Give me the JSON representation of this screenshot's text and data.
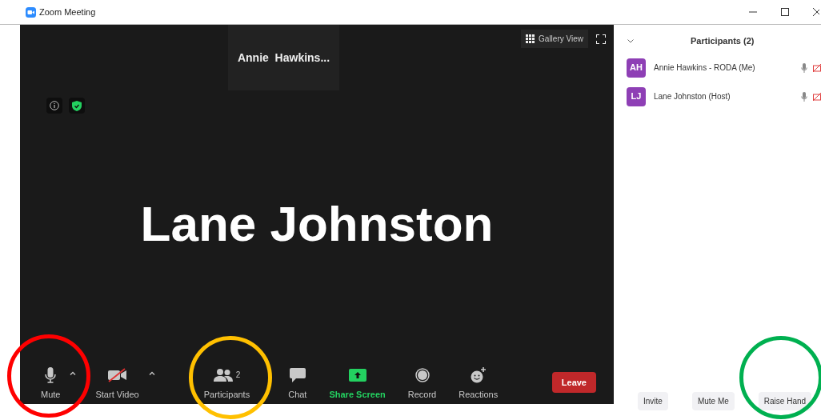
{
  "window": {
    "title": "Zoom Meeting"
  },
  "video": {
    "gallery_button": "Gallery View",
    "thumbnail_name": "Annie  Hawkins...",
    "speaker_name": "Lane Johnston"
  },
  "toolbar": [
    {
      "kind": "mic",
      "label": "Mute",
      "caret": true
    },
    {
      "kind": "video",
      "label": "Start Video",
      "caret": true
    },
    {
      "kind": "participants",
      "label": "Participants",
      "badge": "2",
      "caret": false
    },
    {
      "kind": "chat",
      "label": "Chat",
      "caret": false
    },
    {
      "kind": "share",
      "label": "Share Screen",
      "caret": false
    },
    {
      "kind": "record",
      "label": "Record",
      "caret": false
    },
    {
      "kind": "reactions",
      "label": "Reactions",
      "caret": false
    }
  ],
  "leave_button": "Leave",
  "panel": {
    "title": "Participants (2)",
    "participants": [
      {
        "initials": "AH",
        "name": "Annie Hawkins - RODA (Me)",
        "color": "#8e3fb5",
        "video_off": true
      },
      {
        "initials": "LJ",
        "name": "Lane Johnston (Host)",
        "color": "#8e3fb5",
        "video_off": true
      }
    ],
    "buttons": [
      "Invite",
      "Mute Me",
      "Raise Hand"
    ]
  },
  "annotations": [
    {
      "color": "#ff0000"
    },
    {
      "color": "#ffc000"
    },
    {
      "color": "#00b050"
    }
  ]
}
